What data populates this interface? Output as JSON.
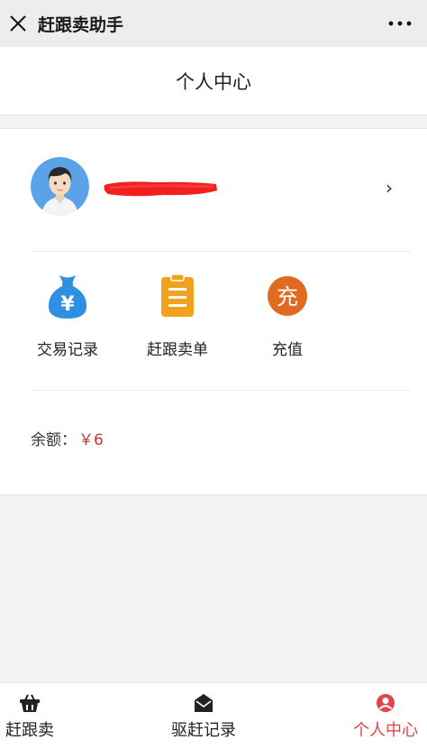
{
  "titlebar": {
    "app_title": "赶跟卖助手"
  },
  "page": {
    "title": "个人中心"
  },
  "profile": {
    "username": ""
  },
  "menu": {
    "items": [
      {
        "label": "交易记录",
        "icon": "money-bag-icon",
        "color": "#2f8fe0"
      },
      {
        "label": "赶跟卖单",
        "icon": "clipboard-icon",
        "color": "#f0a21c"
      },
      {
        "label": "充值",
        "icon": "recharge-icon",
        "color": "#e06a1f",
        "glyph": "充"
      }
    ]
  },
  "balance": {
    "label": "余额：",
    "value": "￥6"
  },
  "tabbar": {
    "items": [
      {
        "label": "赶跟卖",
        "icon": "basket-icon",
        "active": false
      },
      {
        "label": "驱赶记录",
        "icon": "envelope-icon",
        "active": false
      },
      {
        "label": "个人中心",
        "icon": "person-icon",
        "active": true
      }
    ],
    "active_color": "#e0454a"
  },
  "colors": {
    "balance_value": "#c0392b"
  }
}
